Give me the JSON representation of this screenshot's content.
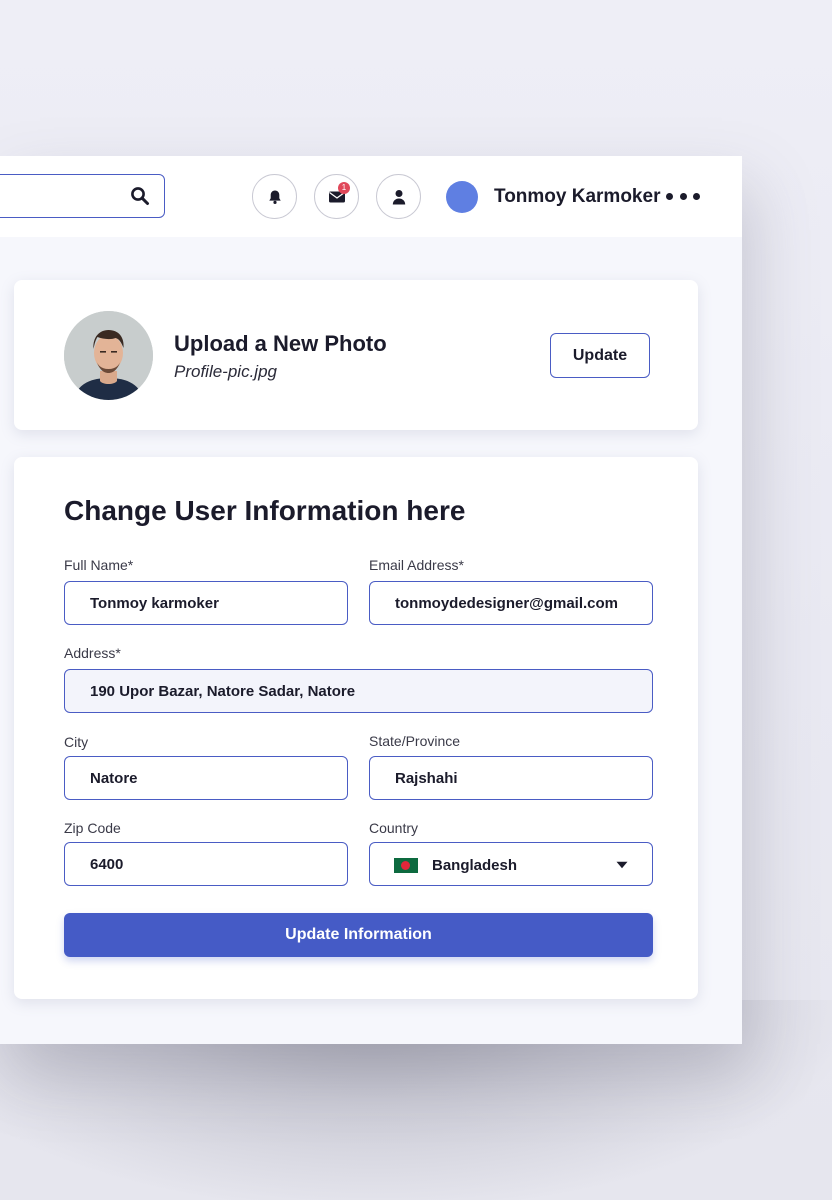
{
  "header": {
    "search": {
      "placeholder": ""
    },
    "icons": [
      "search-icon",
      "bell-icon",
      "mail-icon",
      "user-icon",
      "more-icon"
    ],
    "mail_badge": "1",
    "user_name": "Tonmoy Karmoker",
    "avatar_color": "#5f7fe2"
  },
  "photo_card": {
    "title": "Upload a New Photo",
    "filename": "Profile-pic.jpg",
    "update_label": "Update"
  },
  "form": {
    "title": "Change User Information here",
    "full_name": {
      "label": "Full Name*",
      "value": "Tonmoy karmoker"
    },
    "email": {
      "label": "Email Address*",
      "value": "tonmoydedesigner@gmail.com"
    },
    "address": {
      "label": "Address*",
      "value": "190 Upor Bazar, Natore Sadar, Natore"
    },
    "city": {
      "label": "City",
      "value": "Natore"
    },
    "state": {
      "label": "State/Province",
      "value": "Rajshahi"
    },
    "zip": {
      "label": "Zip Code",
      "value": "6400"
    },
    "country": {
      "label": "Country",
      "value": "Bangladesh",
      "flag": "bangladesh-flag-icon"
    },
    "submit_label": "Update Information"
  },
  "colors": {
    "accent": "#455bc6",
    "border": "#4a5cc4",
    "badge": "#e0485a",
    "background": "#f6f7fc"
  }
}
